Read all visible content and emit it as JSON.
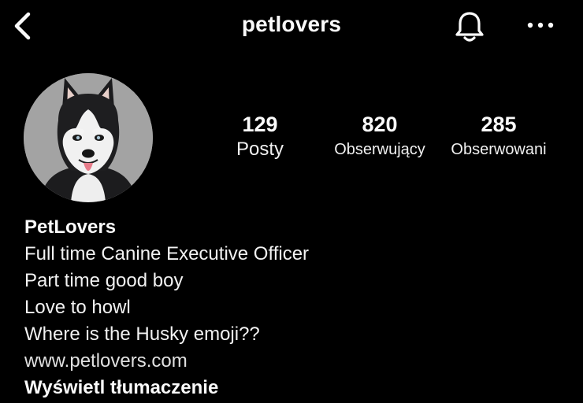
{
  "header": {
    "username": "petlovers",
    "back_icon": "chevron-left-icon",
    "bell_icon": "bell-icon",
    "more_icon": "more-horizontal-icon"
  },
  "profile": {
    "avatar_icon": "husky-avatar",
    "stats": [
      {
        "count": "129",
        "label": "Posty"
      },
      {
        "count": "820",
        "label": "Obserwujący"
      },
      {
        "count": "285",
        "label": "Obserwowani"
      }
    ],
    "display_name": "PetLovers",
    "bio_lines": [
      "Full time Canine Executive Officer",
      "Part time good boy",
      "Love to howl",
      "Where is the Husky emoji??"
    ],
    "website": "www.petlovers.com",
    "translate_label": "Wyświetl tłumaczenie"
  },
  "colors": {
    "background": "#000000",
    "text": "#f5f5f5",
    "avatar_bg": "#9c9c9c"
  }
}
